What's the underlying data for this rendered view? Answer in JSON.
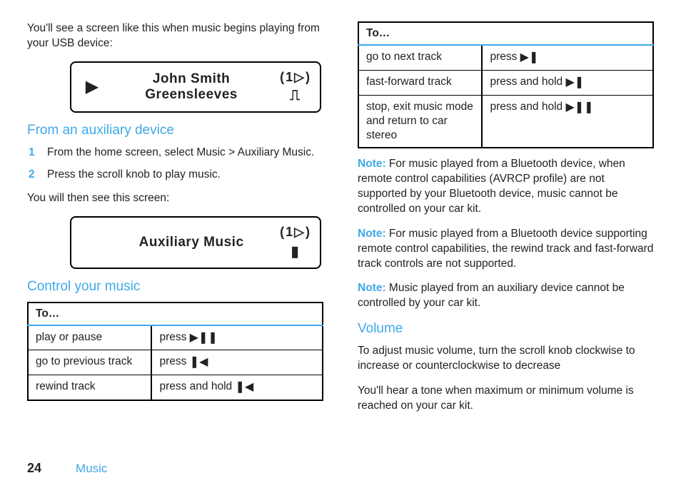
{
  "footer": {
    "page": "24",
    "section": "Music"
  },
  "col1": {
    "intro": "You'll see a screen like this when music begins playing from your USB device:",
    "screen1": {
      "line1": "John Smith",
      "line2": "Greensleeves",
      "top_num": "1",
      "bottom_glyph": "⎍"
    },
    "h_aux": "From an auxiliary device",
    "aux_steps": [
      "From the home screen, select Music > Auxiliary Music.",
      "Press the scroll knob to play music."
    ],
    "aux_after": "You will then see this screen:",
    "screen2": {
      "line1": "Auxiliary Music",
      "top_num": "1",
      "bottom_glyph": "▮"
    },
    "h_ctrl": "Control your music",
    "table_header": "To…",
    "table_rows": [
      {
        "to": "play or pause",
        "action_pre": "press ",
        "glyph": "▶❚❚"
      },
      {
        "to": "go to previous track",
        "action_pre": "press ",
        "glyph": "❚◀"
      },
      {
        "to": "rewind track",
        "action_pre": "press and hold ",
        "glyph": "❚◀"
      }
    ]
  },
  "col2": {
    "table_header": "To…",
    "table_rows": [
      {
        "to": "go to next track",
        "action_pre": "press ",
        "glyph": "▶❚"
      },
      {
        "to": "fast-forward track",
        "action_pre": "press and hold ",
        "glyph": "▶❚"
      },
      {
        "to": "stop, exit music mode and return to car stereo",
        "action_pre": "press and hold ",
        "glyph": "▶❚❚"
      }
    ],
    "note_label": "Note:",
    "notes": [
      "For music played from a Bluetooth device, when remote control capabilities (AVRCP profile) are not supported by your Bluetooth device, music cannot be controlled on your car kit.",
      "For music played from a Bluetooth device supporting remote control capabilities, the rewind track and fast-forward track controls are not supported.",
      "Music played from an auxiliary device cannot be controlled by your car kit."
    ],
    "h_volume": "Volume",
    "vol_p1": "To adjust music volume, turn the scroll knob clockwise to increase or counterclockwise to decrease",
    "vol_p2": "You'll hear a tone when maximum or minimum volume is reached on your car kit."
  }
}
